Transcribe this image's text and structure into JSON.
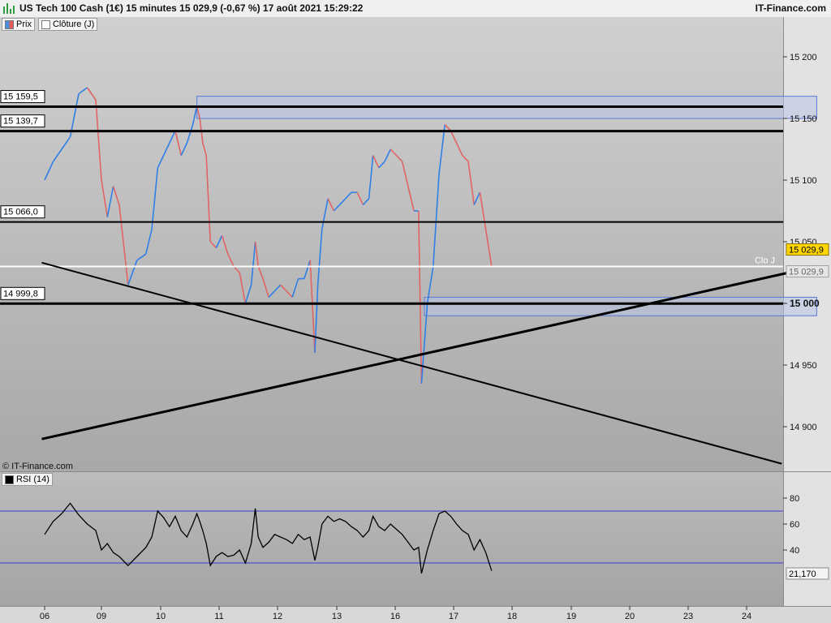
{
  "header": {
    "title": "US Tech 100 Cash (1€) 15 minutes 15 029,9 (-0,67 %) 17 août 2021 15:29:22",
    "brand": "IT-Finance.com"
  },
  "legend": {
    "main": [
      {
        "label": "Prix",
        "color": "#4a8fe0",
        "color2": "#e05a5a"
      },
      {
        "label": "Clôture (J)",
        "color": "#ffffff"
      }
    ],
    "rsi": {
      "label": "RSI (14)",
      "color": "#000000"
    }
  },
  "copyright": "© IT-Finance.com",
  "chart_data": {
    "type": "line",
    "x_ticks": [
      "06",
      "09",
      "10",
      "11",
      "12",
      "13",
      "16",
      "17",
      "18",
      "19",
      "20",
      "23",
      "24"
    ],
    "y_ticks": [
      "15 200",
      "15 150",
      "15 100",
      "15 050",
      "15 000",
      "14 950",
      "14 900"
    ],
    "ylim": [
      14870,
      15235
    ],
    "series": [
      {
        "name": "Prix",
        "points": [
          [
            0,
            15100
          ],
          [
            0.15,
            15115
          ],
          [
            0.3,
            15125
          ],
          [
            0.45,
            15135
          ],
          [
            0.6,
            15170
          ],
          [
            0.75,
            15175
          ],
          [
            0.9,
            15165
          ],
          [
            1.0,
            15100
          ],
          [
            1.1,
            15070
          ],
          [
            1.2,
            15095
          ],
          [
            1.3,
            15080
          ],
          [
            1.45,
            15015
          ],
          [
            1.6,
            15035
          ],
          [
            1.75,
            15040
          ],
          [
            1.85,
            15060
          ],
          [
            1.95,
            15110
          ],
          [
            2.05,
            15120
          ],
          [
            2.15,
            15130
          ],
          [
            2.25,
            15140
          ],
          [
            2.35,
            15120
          ],
          [
            2.45,
            15130
          ],
          [
            2.55,
            15145
          ],
          [
            2.62,
            15160
          ],
          [
            2.67,
            15150
          ],
          [
            2.72,
            15130
          ],
          [
            2.78,
            15120
          ],
          [
            2.85,
            15050
          ],
          [
            2.95,
            15045
          ],
          [
            3.05,
            15055
          ],
          [
            3.15,
            15040
          ],
          [
            3.25,
            15030
          ],
          [
            3.35,
            15025
          ],
          [
            3.45,
            15000
          ],
          [
            3.55,
            15015
          ],
          [
            3.62,
            15050
          ],
          [
            3.67,
            15030
          ],
          [
            3.75,
            15020
          ],
          [
            3.85,
            15005
          ],
          [
            3.95,
            15010
          ],
          [
            4.05,
            15015
          ],
          [
            4.15,
            15010
          ],
          [
            4.25,
            15005
          ],
          [
            4.35,
            15020
          ],
          [
            4.45,
            15020
          ],
          [
            4.55,
            15035
          ],
          [
            4.63,
            14960
          ],
          [
            4.68,
            15015
          ],
          [
            4.75,
            15060
          ],
          [
            4.85,
            15085
          ],
          [
            4.95,
            15075
          ],
          [
            5.05,
            15080
          ],
          [
            5.15,
            15085
          ],
          [
            5.25,
            15090
          ],
          [
            5.35,
            15090
          ],
          [
            5.45,
            15080
          ],
          [
            5.55,
            15085
          ],
          [
            5.62,
            15120
          ],
          [
            5.72,
            15110
          ],
          [
            5.82,
            15115
          ],
          [
            5.92,
            15125
          ],
          [
            6.02,
            15120
          ],
          [
            6.12,
            15115
          ],
          [
            6.22,
            15095
          ],
          [
            6.32,
            15075
          ],
          [
            6.4,
            15075
          ],
          [
            6.45,
            14935
          ],
          [
            6.55,
            15000
          ],
          [
            6.65,
            15030
          ],
          [
            6.75,
            15105
          ],
          [
            6.85,
            15145
          ],
          [
            6.95,
            15140
          ],
          [
            7.05,
            15130
          ],
          [
            7.15,
            15120
          ],
          [
            7.25,
            15115
          ],
          [
            7.35,
            15080
          ],
          [
            7.45,
            15090
          ],
          [
            7.55,
            15060
          ],
          [
            7.65,
            15030
          ]
        ]
      },
      {
        "name": "RSI (14)",
        "points": [
          [
            0,
            52
          ],
          [
            0.15,
            62
          ],
          [
            0.3,
            68
          ],
          [
            0.45,
            76
          ],
          [
            0.6,
            67
          ],
          [
            0.75,
            60
          ],
          [
            0.9,
            55
          ],
          [
            1.0,
            40
          ],
          [
            1.1,
            45
          ],
          [
            1.2,
            38
          ],
          [
            1.3,
            35
          ],
          [
            1.45,
            28
          ],
          [
            1.6,
            35
          ],
          [
            1.75,
            42
          ],
          [
            1.85,
            50
          ],
          [
            1.95,
            70
          ],
          [
            2.05,
            65
          ],
          [
            2.15,
            58
          ],
          [
            2.25,
            66
          ],
          [
            2.35,
            55
          ],
          [
            2.45,
            50
          ],
          [
            2.55,
            60
          ],
          [
            2.62,
            68
          ],
          [
            2.67,
            62
          ],
          [
            2.72,
            55
          ],
          [
            2.78,
            45
          ],
          [
            2.85,
            28
          ],
          [
            2.95,
            35
          ],
          [
            3.05,
            38
          ],
          [
            3.15,
            35
          ],
          [
            3.25,
            36
          ],
          [
            3.35,
            40
          ],
          [
            3.45,
            30
          ],
          [
            3.55,
            45
          ],
          [
            3.62,
            72
          ],
          [
            3.67,
            50
          ],
          [
            3.75,
            42
          ],
          [
            3.85,
            46
          ],
          [
            3.95,
            52
          ],
          [
            4.05,
            50
          ],
          [
            4.15,
            48
          ],
          [
            4.25,
            45
          ],
          [
            4.35,
            52
          ],
          [
            4.45,
            48
          ],
          [
            4.55,
            50
          ],
          [
            4.63,
            32
          ],
          [
            4.68,
            42
          ],
          [
            4.75,
            60
          ],
          [
            4.85,
            66
          ],
          [
            4.95,
            62
          ],
          [
            5.05,
            64
          ],
          [
            5.15,
            62
          ],
          [
            5.25,
            58
          ],
          [
            5.35,
            55
          ],
          [
            5.45,
            50
          ],
          [
            5.55,
            55
          ],
          [
            5.62,
            66
          ],
          [
            5.72,
            58
          ],
          [
            5.82,
            55
          ],
          [
            5.92,
            60
          ],
          [
            6.02,
            56
          ],
          [
            6.12,
            52
          ],
          [
            6.22,
            46
          ],
          [
            6.32,
            40
          ],
          [
            6.4,
            42
          ],
          [
            6.45,
            22
          ],
          [
            6.55,
            40
          ],
          [
            6.65,
            55
          ],
          [
            6.75,
            68
          ],
          [
            6.85,
            70
          ],
          [
            6.95,
            66
          ],
          [
            7.05,
            60
          ],
          [
            7.15,
            55
          ],
          [
            7.25,
            52
          ],
          [
            7.35,
            40
          ],
          [
            7.45,
            48
          ],
          [
            7.55,
            38
          ],
          [
            7.65,
            24
          ]
        ]
      }
    ],
    "levels": [
      {
        "label": "15 159,5",
        "value": 15159.5
      },
      {
        "label": "15 139,7",
        "value": 15139.7
      },
      {
        "label": "15 066,0",
        "value": 15066.0
      },
      {
        "label": "14 999,8",
        "value": 14999.8
      }
    ],
    "close_line": {
      "value": 15029.9,
      "label": "Clo J"
    },
    "price_tags": {
      "current": "15 029,9",
      "close": "15 029,9",
      "round": "15 000"
    },
    "zones": [
      {
        "x_from": 2.62,
        "x_to": 13.2,
        "y_from": 15150,
        "y_to": 15168
      },
      {
        "x_from": 6.5,
        "x_to": 13.2,
        "y_from": 14990,
        "y_to": 15005
      }
    ],
    "trendlines": [
      {
        "x1": -0.05,
        "y1": 14890,
        "x2": 13.2,
        "y2": 15030
      },
      {
        "x1": -0.05,
        "y1": 15033,
        "x2": 12.6,
        "y2": 14870
      }
    ],
    "rsi": {
      "y_ticks": [
        "80",
        "60",
        "40"
      ],
      "ylim": [
        10,
        90
      ],
      "bands": [
        70,
        30
      ],
      "last_value": "21,170"
    }
  }
}
